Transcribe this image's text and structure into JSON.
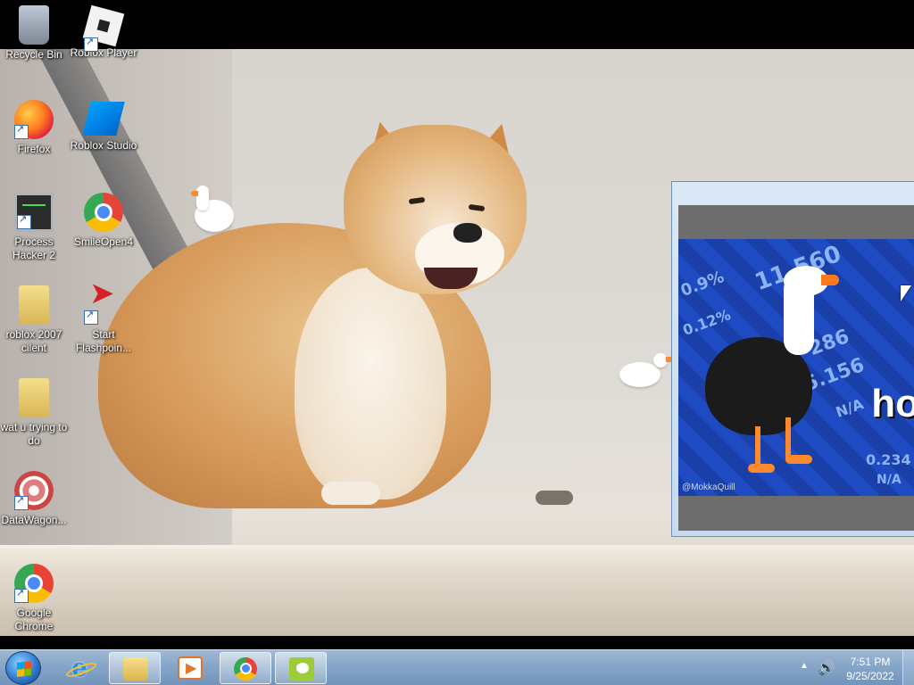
{
  "desktop": {
    "icons": [
      {
        "label": "Recycle Bin",
        "icon": "recycle-bin-icon"
      },
      {
        "label": "Roblox Player",
        "icon": "roblox-icon"
      },
      {
        "label": "Firefox",
        "icon": "firefox-icon"
      },
      {
        "label": "Roblox Studio",
        "icon": "roblox-studio-icon"
      },
      {
        "label": "Process Hacker 2",
        "icon": "process-hacker-icon"
      },
      {
        "label": "SmileOpen4",
        "icon": "chrome-icon"
      },
      {
        "label": "roblox 2007 cilent",
        "icon": "folder-icon"
      },
      {
        "label": "Start Flashpoin...",
        "icon": "flashpoint-icon"
      },
      {
        "label": "wat u trying to do",
        "icon": "folder-icon"
      },
      {
        "label": "DataWagon...",
        "icon": "datawagon-icon"
      },
      {
        "label": "Google Chrome",
        "icon": "chrome-icon"
      }
    ]
  },
  "meme_window": {
    "watermark": "@MokkaQuill",
    "big_text": "ho",
    "ticker": [
      "11.560",
      "0.9%",
      "0.12%",
      "286",
      "5.156",
      "N/A",
      "0.234",
      "N/A"
    ]
  },
  "taskbar": {
    "pinned": [
      {
        "name": "internet-explorer",
        "icon": "internet-explorer-icon"
      },
      {
        "name": "windows-explorer",
        "icon": "folder-icon"
      },
      {
        "name": "media-player",
        "icon": "media-player-icon"
      },
      {
        "name": "chrome",
        "icon": "chrome-icon"
      },
      {
        "name": "desktop-goose",
        "icon": "goose-icon"
      }
    ],
    "tray": {
      "time": "7:51 PM",
      "date": "9/25/2022"
    }
  },
  "colors": {
    "taskbar": "#86a6c8",
    "meme_bg": "#1e4bc2",
    "window_frame": "#c6dbef"
  }
}
